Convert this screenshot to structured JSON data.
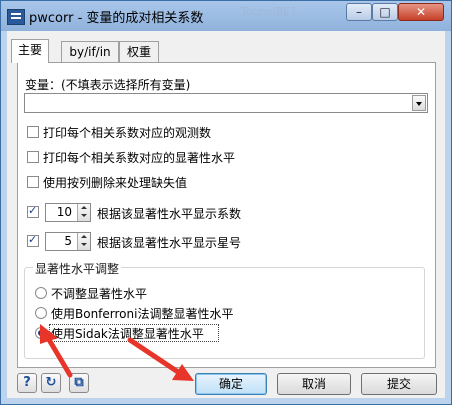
{
  "window": {
    "title": "pwcorr - 变量的成对相关系数",
    "ghost_text": "Tourwi8E1"
  },
  "tabs": [
    {
      "label": "主要",
      "active": true
    },
    {
      "label": "by/if/in",
      "active": false
    },
    {
      "label": "权重",
      "active": false
    }
  ],
  "main": {
    "variables_label": "变量：(不填表示选择所有变量)",
    "variables_value": "",
    "options": [
      {
        "label": "打印每个相关系数对应的观测数",
        "checked": false
      },
      {
        "label": "打印每个相关系数对应的显著性水平",
        "checked": false
      },
      {
        "label": "使用按列删除来处理缺失值",
        "checked": false
      }
    ],
    "sig_coef": {
      "checked": true,
      "value": "10",
      "label": "根据该显著性水平显示系数"
    },
    "sig_star": {
      "checked": true,
      "value": "5",
      "label": "根据该显著性水平显示星号"
    },
    "adjust_group": {
      "title": "显著性水平调整",
      "options": [
        {
          "label": "不调整显著性水平",
          "selected": false
        },
        {
          "label": "使用Bonferroni法调整显著性水平",
          "selected": false
        },
        {
          "label": "使用Sidak法调整显著性水平",
          "selected": true
        }
      ]
    }
  },
  "footer": {
    "help_icon": "?",
    "reset_icon": "↻",
    "copy_icon": "⧉",
    "ok_label": "确定",
    "cancel_label": "取消",
    "submit_label": "提交"
  },
  "colors": {
    "annotation_arrow": "#e8352a",
    "accent": "#1a3c8c"
  }
}
